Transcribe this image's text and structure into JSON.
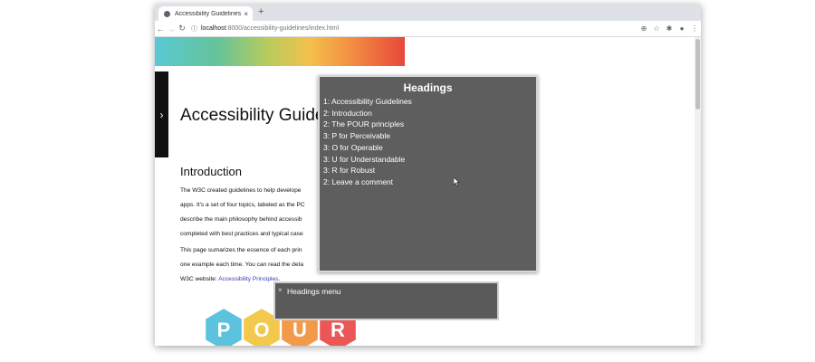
{
  "browser": {
    "tab": {
      "title": "Accessibility Guidelines",
      "close_glyph": "×"
    },
    "new_tab_glyph": "+",
    "toolbar": {
      "back_glyph": "←",
      "forward_glyph": "→",
      "reload_glyph": "↻",
      "url_host": "localhost",
      "url_path": ":8000/accessibility-guidelines/index.html",
      "zoom_glyph": "⊕",
      "star_glyph": "☆",
      "extensions_glyph": "✱",
      "profile_glyph": "●",
      "menu_glyph": "⋮"
    }
  },
  "page": {
    "sidebar_toggle_glyph": "›",
    "title": "Accessibility Guide",
    "section_heading": "Introduction",
    "paragraphs": [
      {
        "lines": [
          "The W3C created guidelines to help develope",
          "apps. It's a set of four topics, labeled as the PC",
          "describe the main philosophy behind accessib",
          "completed with best practices and typical case"
        ]
      },
      {
        "lines": [
          "This page sumarizes the essence of each prin",
          "one example each time. You can read the deta",
          "W3C website: "
        ],
        "link_text": "Accessibility Principles",
        "tail": "."
      }
    ],
    "logo_letters": [
      "P",
      "O",
      "U",
      "R"
    ],
    "logo_colors": [
      "#5bc3de",
      "#f2c94c",
      "#f2994a",
      "#eb5757"
    ]
  },
  "headings_panel": {
    "title": "Headings",
    "items": [
      "1: Accessibility Guidelines",
      "2: Introduction",
      "2: The POUR principles",
      "3: P for Perceivable",
      "3: O for Operable",
      "3: U for Understandable",
      "3: R for Robust",
      "2: Leave a comment"
    ]
  },
  "headings_menu": {
    "close_glyph": "×",
    "label": "Headings menu"
  }
}
